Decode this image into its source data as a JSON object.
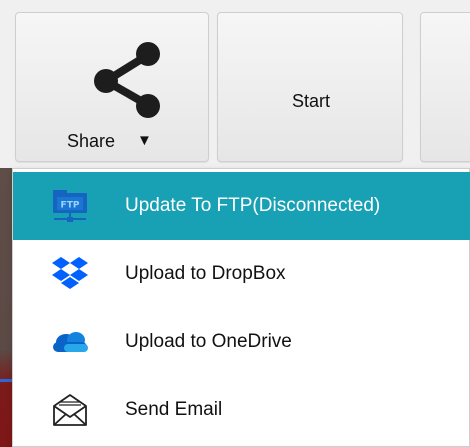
{
  "toolbar": {
    "share": {
      "label": "Share",
      "caret": "▼",
      "icon": "share-icon"
    },
    "start": {
      "label": "Start"
    }
  },
  "menu": {
    "items": [
      {
        "label": "Update To FTP(Disconnected)",
        "icon": "ftp-folder-icon",
        "active": true
      },
      {
        "label": "Upload to DropBox",
        "icon": "dropbox-icon",
        "active": false
      },
      {
        "label": "Upload to OneDrive",
        "icon": "onedrive-icon",
        "active": false
      },
      {
        "label": "Send Email",
        "icon": "envelope-icon",
        "active": false
      }
    ]
  },
  "colors": {
    "highlight": "#18a0b4",
    "dropbox_blue": "#0061fe",
    "onedrive_blue": "#0a64c8",
    "ftp_blue": "#1565c0"
  }
}
